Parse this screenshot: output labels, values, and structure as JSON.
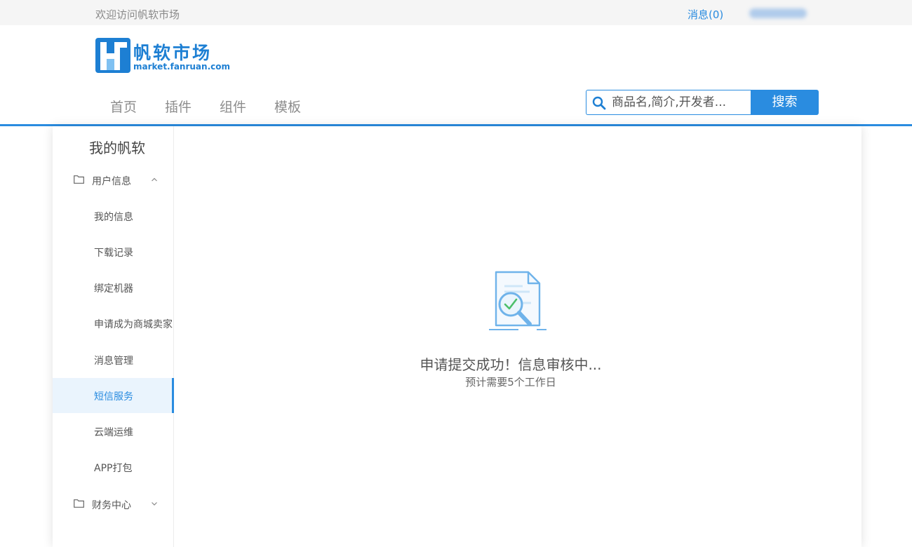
{
  "topbar": {
    "welcome": "欢迎访问帆软市场",
    "messages": "消息(0)"
  },
  "logo": {
    "name": "帆软市场",
    "url": "market.fanruan.com"
  },
  "nav": {
    "items": [
      "首页",
      "插件",
      "组件",
      "模板"
    ]
  },
  "search": {
    "placeholder": "商品名,简介,开发者...",
    "button": "搜索"
  },
  "sidebar": {
    "title": "我的帆软",
    "groups": [
      {
        "label": "用户信息",
        "expanded": true
      },
      {
        "label": "财务中心",
        "expanded": false
      }
    ],
    "items": [
      "我的信息",
      "下载记录",
      "绑定机器",
      "申请成为商城卖家",
      "消息管理",
      "短信服务",
      "云端运维",
      "APP打包"
    ],
    "active_item": "短信服务"
  },
  "content": {
    "status": "申请提交成功！信息审核中...",
    "subtext": "预计需要5个工作日"
  },
  "colors": {
    "accent": "#2a8ce0",
    "active_bg": "#eaf4fd",
    "topbar_bg": "#f5f5f5"
  },
  "icons": [
    "search-icon",
    "folder-icon",
    "chevron-up-icon",
    "chevron-down-icon",
    "document-check-icon"
  ]
}
